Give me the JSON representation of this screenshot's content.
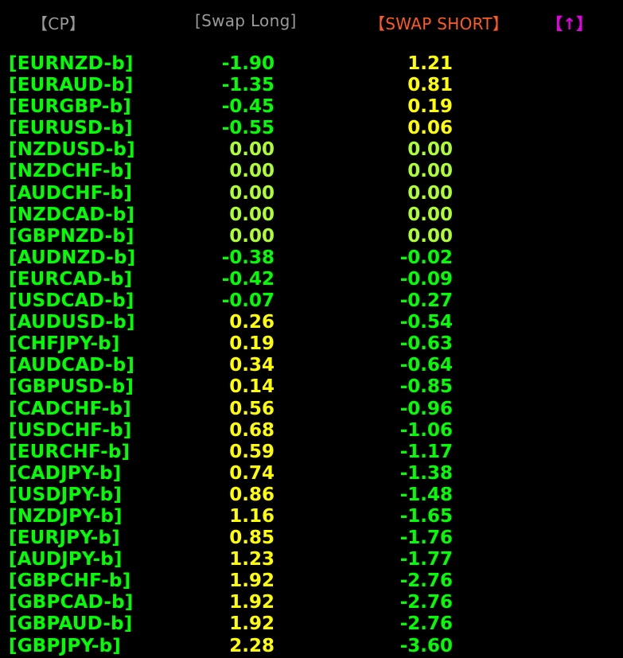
{
  "header": {
    "cp_label": "【CP】",
    "swap_long_label": "[Swap Long]",
    "swap_short_label": "【SWAP SHORT】",
    "sort_label": "【↑】"
  },
  "colors": {
    "background": "#000000",
    "header_cp": "#9a9a9a",
    "header_long": "#9a9a9a",
    "header_short": "#ff5a1f",
    "header_sort": "#e600e6",
    "pair_text": "#00ff00",
    "value_negative": "#00ff00",
    "value_zero": "#adff2f",
    "value_positive": "#ffff00"
  },
  "rows": [
    {
      "pair": "[EURNZD-b]",
      "long": "-1.90",
      "short": "1.21"
    },
    {
      "pair": "[EURAUD-b]",
      "long": "-1.35",
      "short": "0.81"
    },
    {
      "pair": "[EURGBP-b]",
      "long": "-0.45",
      "short": "0.19"
    },
    {
      "pair": "[EURUSD-b]",
      "long": "-0.55",
      "short": "0.06"
    },
    {
      "pair": "[NZDUSD-b]",
      "long": "0.00",
      "short": "0.00"
    },
    {
      "pair": "[NZDCHF-b]",
      "long": "0.00",
      "short": "0.00"
    },
    {
      "pair": "[AUDCHF-b]",
      "long": "0.00",
      "short": "0.00"
    },
    {
      "pair": "[NZDCAD-b]",
      "long": "0.00",
      "short": "0.00"
    },
    {
      "pair": "[GBPNZD-b]",
      "long": "0.00",
      "short": "0.00"
    },
    {
      "pair": "[AUDNZD-b]",
      "long": "-0.38",
      "short": "-0.02"
    },
    {
      "pair": "[EURCAD-b]",
      "long": "-0.42",
      "short": "-0.09"
    },
    {
      "pair": "[USDCAD-b]",
      "long": "-0.07",
      "short": "-0.27"
    },
    {
      "pair": "[AUDUSD-b]",
      "long": "0.26",
      "short": "-0.54"
    },
    {
      "pair": "[CHFJPY-b]",
      "long": "0.19",
      "short": "-0.63"
    },
    {
      "pair": "[AUDCAD-b]",
      "long": "0.34",
      "short": "-0.64"
    },
    {
      "pair": "[GBPUSD-b]",
      "long": "0.14",
      "short": "-0.85"
    },
    {
      "pair": "[CADCHF-b]",
      "long": "0.56",
      "short": "-0.96"
    },
    {
      "pair": "[USDCHF-b]",
      "long": "0.68",
      "short": "-1.06"
    },
    {
      "pair": "[EURCHF-b]",
      "long": "0.59",
      "short": "-1.17"
    },
    {
      "pair": "[CADJPY-b]",
      "long": "0.74",
      "short": "-1.38"
    },
    {
      "pair": "[USDJPY-b]",
      "long": "0.86",
      "short": "-1.48"
    },
    {
      "pair": "[NZDJPY-b]",
      "long": "1.16",
      "short": "-1.65"
    },
    {
      "pair": "[EURJPY-b]",
      "long": "0.85",
      "short": "-1.76"
    },
    {
      "pair": "[AUDJPY-b]",
      "long": "1.23",
      "short": "-1.77"
    },
    {
      "pair": "[GBPCHF-b]",
      "long": "1.92",
      "short": "-2.76"
    },
    {
      "pair": "[GBPCAD-b]",
      "long": "1.92",
      "short": "-2.76"
    },
    {
      "pair": "[GBPAUD-b]",
      "long": "1.92",
      "short": "-2.76"
    },
    {
      "pair": "[GBPJPY-b]",
      "long": "2.28",
      "short": "-3.60"
    }
  ]
}
